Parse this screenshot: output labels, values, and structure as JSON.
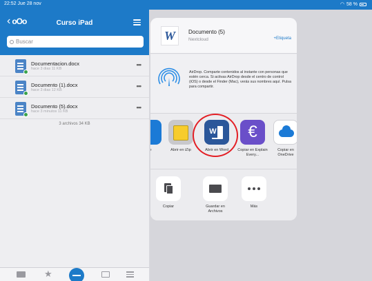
{
  "status_bar": {
    "time": "22:52  Jue 28 nov",
    "battery": "58 %"
  },
  "left_pane": {
    "back_logo": "oOo",
    "title": "Curso iPad",
    "search": {
      "placeholder": "Buscar"
    },
    "files": [
      {
        "name": "Documentacion.docx",
        "meta": "hace 3 dias 11 KB"
      },
      {
        "name": "Documento (1).docx",
        "meta": "hace 3 dias 12 KB"
      },
      {
        "name": "Documento (5).docx",
        "meta": "hace 3 minutos 11 KB"
      }
    ],
    "file_count": "3 archivos 34 KB"
  },
  "share_sheet": {
    "doc_title": "Documento (5)",
    "doc_subtitle": "Nextcloud",
    "tag_button": "+Etiqueta",
    "airdrop_text": "AirDrop. Comparte contenidos al instante con personas que estén cerca. Si activas AirDrop desde el centro de control (iOS) o desde el Finder (Mac), verás sus nombres aquí. Pulsa para compartir.",
    "apps": [
      {
        "label": "ive",
        "icon": "cloud-app-icon"
      },
      {
        "label": "Abrir en iZip",
        "icon": "izip-icon"
      },
      {
        "label": "Abrir en Word",
        "icon": "word-icon"
      },
      {
        "label": "Copiar en Explain Every...",
        "icon": "explain-everything-icon"
      },
      {
        "label": "Copiar en OneDrive",
        "icon": "onedrive-icon"
      }
    ],
    "actions": [
      {
        "label": "Copiar",
        "icon": "copy-icon"
      },
      {
        "label": "Guardar en Archivos",
        "icon": "folder-icon"
      },
      {
        "label": "Más",
        "icon": "more-icon"
      }
    ]
  },
  "colors": {
    "header_blue": "#1d7ac8",
    "highlight_red": "#e31e24",
    "word_blue": "#2b579a"
  }
}
